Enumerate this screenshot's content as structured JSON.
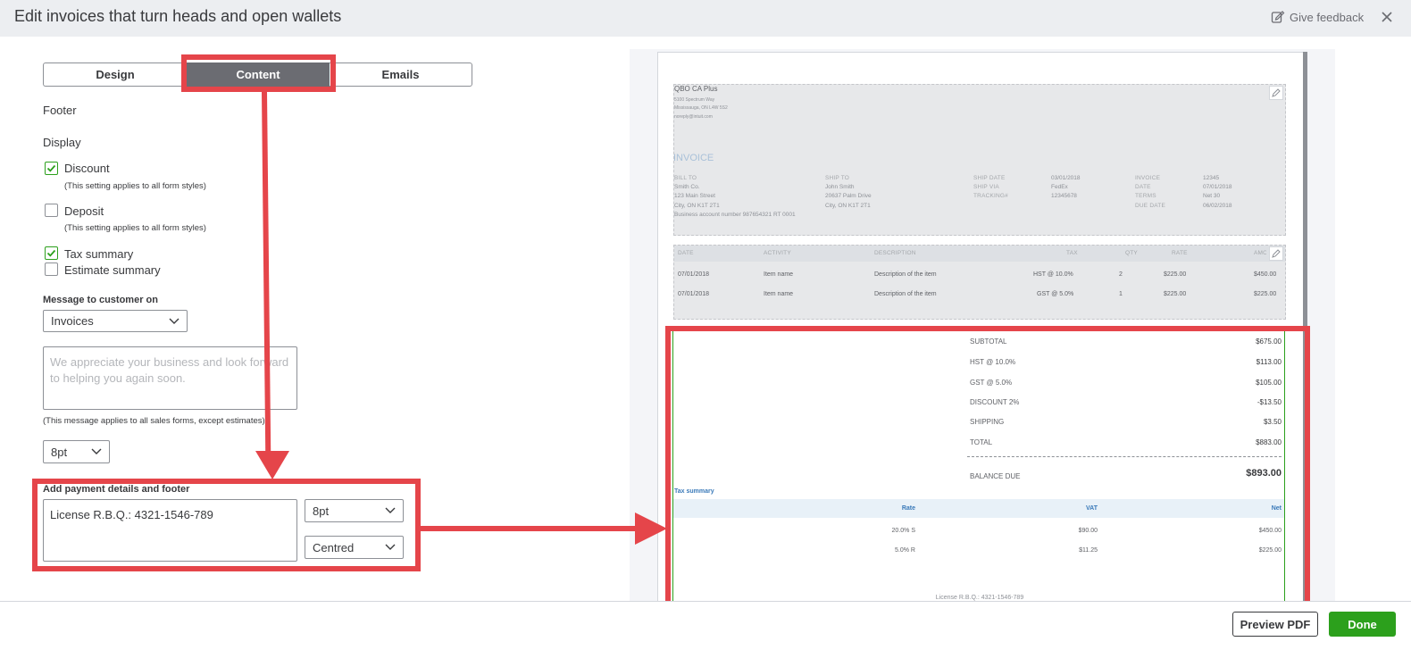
{
  "header": {
    "title": "Edit invoices that turn heads and open wallets",
    "feedback_label": "Give feedback"
  },
  "tabs": [
    {
      "label": "Design"
    },
    {
      "label": "Content"
    },
    {
      "label": "Emails"
    }
  ],
  "section": {
    "footer_label": "Footer",
    "display_label": "Display"
  },
  "checkboxes": [
    {
      "label": "Discount",
      "checked": true,
      "note": "(This setting applies to all form styles)"
    },
    {
      "label": "Deposit",
      "checked": false,
      "note": "(This setting applies to all form styles)"
    },
    {
      "label": "Tax summary",
      "checked": true
    },
    {
      "label": "Estimate summary",
      "checked": false
    }
  ],
  "message": {
    "label": "Message to customer on",
    "form_select": "Invoices",
    "placeholder": "We appreciate your business and look forward to helping you again soon.",
    "note": "(This message applies to all sales forms, except estimates)",
    "font_size": "8pt"
  },
  "payment": {
    "label": "Add payment details and footer",
    "value": "License R.B.Q.: 4321-1546-789",
    "font_size": "8pt",
    "alignment": "Centred"
  },
  "preview": {
    "company": {
      "name": "QBO CA Plus",
      "address1": "5100 Spectrum Way",
      "address2": "Mississauga, ON L4W 5S2",
      "email": "noreply@intuit.com"
    },
    "invoice_title": "INVOICE",
    "bill_to": {
      "label": "BILL TO",
      "lines": [
        "Smith Co.",
        "123 Main Street",
        "City, ON K1T 2T1",
        "Business account number 987654321 RT 0001"
      ]
    },
    "ship_to": {
      "label": "SHIP TO",
      "lines": [
        "John Smith",
        "20637 Palm Drive",
        "City, ON K1T 2T1"
      ]
    },
    "ship_info": {
      "labels": [
        "SHIP DATE",
        "SHIP VIA",
        "TRACKING#"
      ],
      "values": [
        "03/01/2018",
        "FedEx",
        "12345678"
      ]
    },
    "invoice_info": {
      "labels": [
        "INVOICE",
        "DATE",
        "TERMS",
        "DUE DATE"
      ],
      "values": [
        "12345",
        "07/01/2018",
        "Net 30",
        "06/02/2018"
      ]
    },
    "table": {
      "headers": [
        "DATE",
        "ACTIVITY",
        "DESCRIPTION",
        "TAX",
        "QTY",
        "RATE",
        "AMOUNT"
      ],
      "rows": [
        [
          "07/01/2018",
          "Item name",
          "Description of the item",
          "HST @ 10.0%",
          "2",
          "$225.00",
          "$450.00"
        ],
        [
          "07/01/2018",
          "Item name",
          "Description of the item",
          "GST @ 5.0%",
          "1",
          "$225.00",
          "$225.00"
        ]
      ]
    },
    "totals": [
      {
        "label": "SUBTOTAL",
        "value": "$675.00"
      },
      {
        "label": "HST @ 10.0%",
        "value": "$113.00"
      },
      {
        "label": "GST @ 5.0%",
        "value": "$105.00"
      },
      {
        "label": "DISCOUNT 2%",
        "value": "-$13.50"
      },
      {
        "label": "SHIPPING",
        "value": "$3.50"
      },
      {
        "label": "TOTAL",
        "value": "$883.00"
      }
    ],
    "balance_due": {
      "label": "BALANCE DUE",
      "value": "$893.00"
    },
    "tax_summary": {
      "title": "Tax summary",
      "headers": [
        "Rate",
        "VAT",
        "Net"
      ],
      "rows": [
        [
          "20.0% S",
          "$90.00",
          "$450.00"
        ],
        [
          "5.0% R",
          "$11.25",
          "$225.00"
        ]
      ]
    },
    "footer_text": "License R.B.Q.: 4321-1546-789"
  },
  "buttons": {
    "preview_pdf": "Preview PDF",
    "done": "Done"
  },
  "colors": {
    "accent_green": "#2ca01c",
    "annotation_red": "#e5454a",
    "tab_active": "#6b6c72",
    "header_bg": "#eceef1"
  }
}
